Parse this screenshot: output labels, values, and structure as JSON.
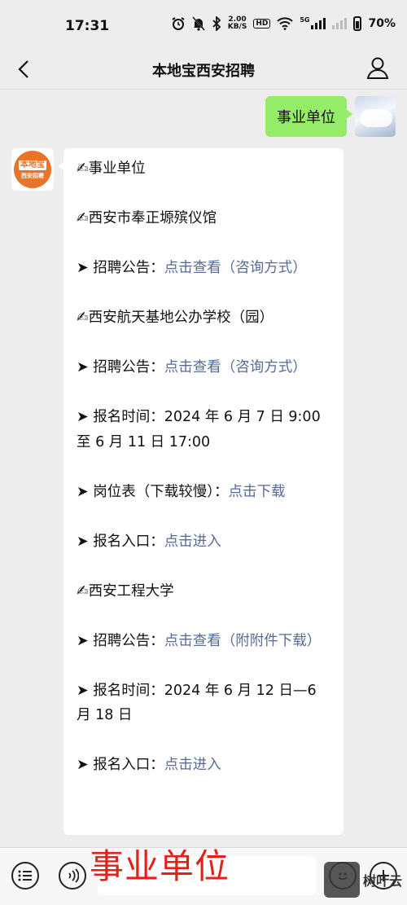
{
  "status_bar": {
    "time": "17:31",
    "net_speed_value": "2.00",
    "net_speed_unit": "KB/S",
    "hd_label": "HD",
    "network_5g": "5G",
    "battery_percent": "70%"
  },
  "header": {
    "title": "本地宝西安招聘"
  },
  "chat": {
    "outgoing": {
      "text": "事业单位"
    },
    "incoming": {
      "bot_logo_main": "本地宝",
      "bot_logo_sub": "西安招聘",
      "lines": [
        {
          "prefix": "✍事业单位",
          "link": ""
        },
        {
          "prefix": "✍西安市奉正塬殡仪馆",
          "link": ""
        },
        {
          "prefix": "➤ 招聘公告：",
          "link": "点击查看（咨询方式）"
        },
        {
          "prefix": "✍西安航天基地公办学校（园）",
          "link": ""
        },
        {
          "prefix": "➤ 招聘公告：",
          "link": "点击查看（咨询方式）"
        },
        {
          "prefix": "➤ 报名时间：2024 年 6 月 7 日 9:00 至 6 月 11 日 17:00",
          "link": ""
        },
        {
          "prefix": "➤ 岗位表（下载较慢）：",
          "link": "点击下载"
        },
        {
          "prefix": "➤ 报名入口：",
          "link": "点击进入"
        },
        {
          "prefix": "✍西安工程大学",
          "link": ""
        },
        {
          "prefix": "➤ 招聘公告：",
          "link": "点击查看（附附件下载）"
        },
        {
          "prefix": "➤ 报名时间：2024 年 6 月 12 日—6 月 18 日",
          "link": ""
        },
        {
          "prefix": "➤ 报名入口：",
          "link": "点击进入"
        }
      ]
    }
  },
  "overlay_caption": "事业单位",
  "watermark": {
    "text": "树叶云"
  }
}
